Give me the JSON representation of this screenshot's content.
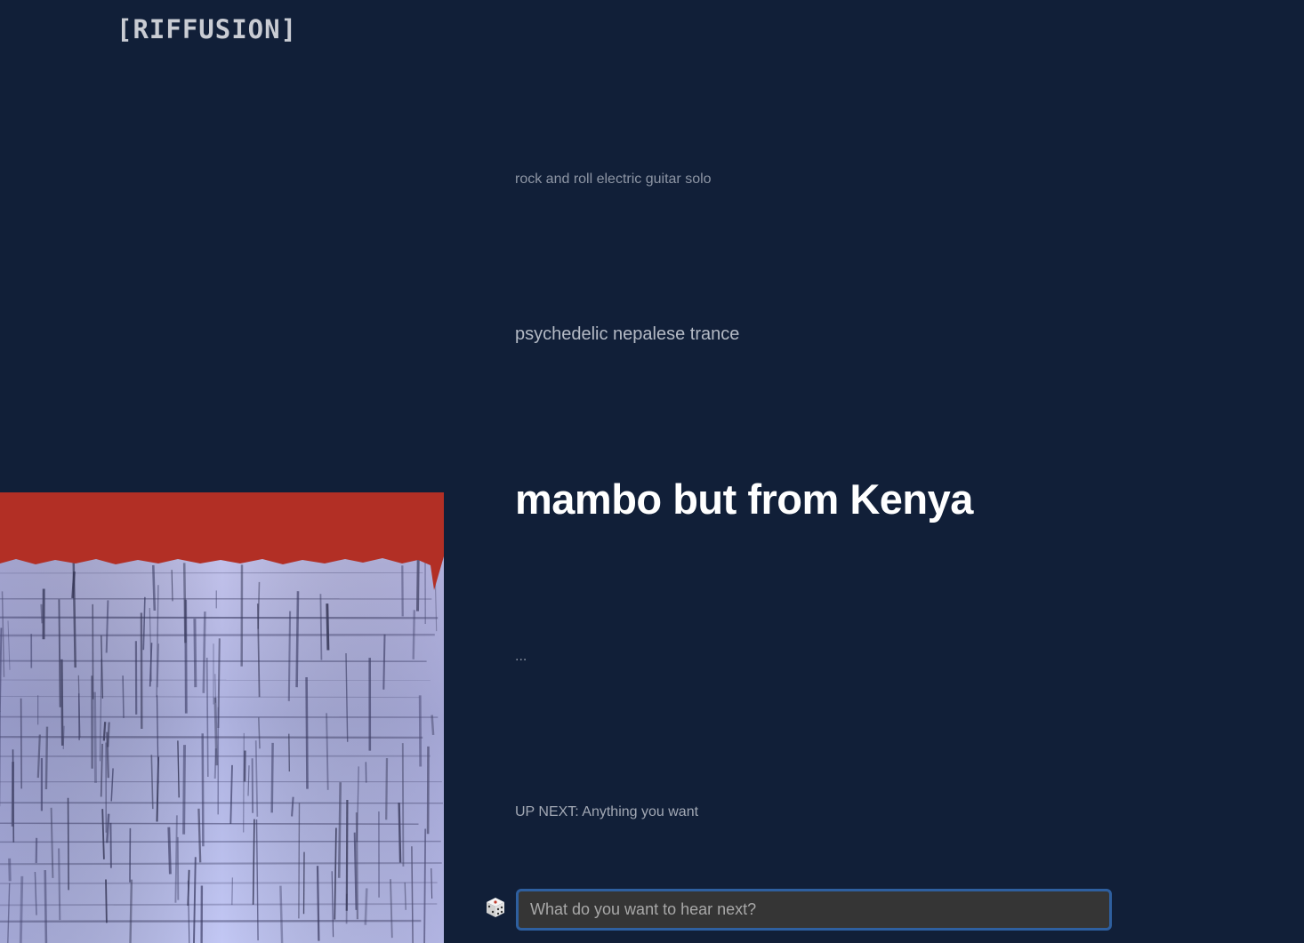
{
  "header": {
    "logo_text": "[RIFFUSION]"
  },
  "prompts": {
    "previous": [
      "rock and roll electric guitar solo",
      "psychedelic nepalese trance"
    ],
    "current": "mambo but from Kenya",
    "pending": "..."
  },
  "up_next": "UP NEXT: Anything you want",
  "input": {
    "placeholder": "What do you want to hear next?",
    "value": ""
  },
  "icons": {
    "randomize": "dice-icon"
  },
  "colors": {
    "background": "#111f38",
    "spectrogram_top": "#b22f25",
    "spectrogram_body": "#b9bfe8",
    "input_border": "#2e5f9f",
    "input_background": "#353535"
  }
}
